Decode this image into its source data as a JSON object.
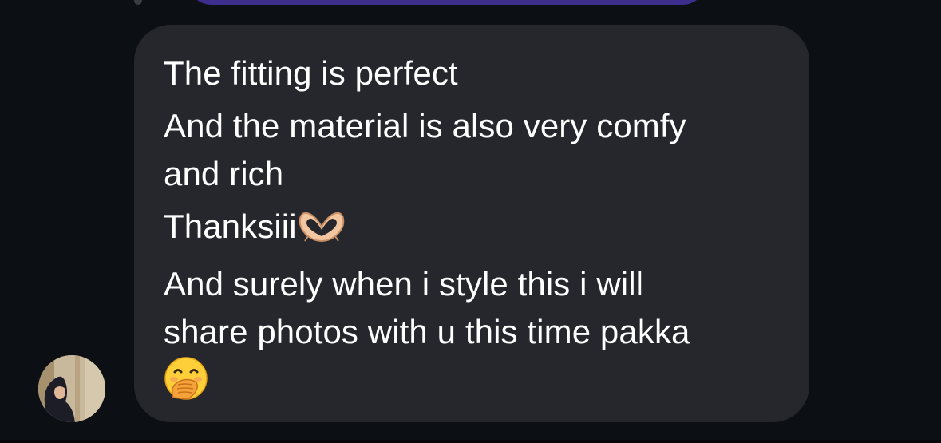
{
  "message": {
    "lines": [
      "The fitting is perfect",
      "And the material is also very comfy",
      "and rich",
      "Thanksiii",
      "And surely when i style this i will",
      "share photos with u this time pakka"
    ]
  },
  "icons": {
    "heart_hands": "heart-hands-emoji",
    "hand_over_mouth": "face-with-hand-over-mouth-emoji"
  },
  "colors": {
    "background": "#0c0f14",
    "bubble": "#25272c",
    "previous_bubble": "#3d2d8c",
    "text": "#ffffff"
  }
}
